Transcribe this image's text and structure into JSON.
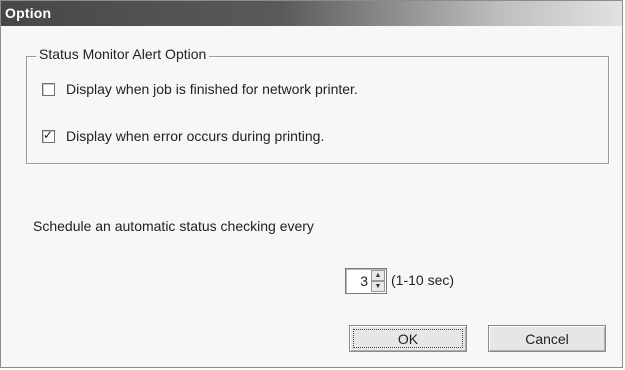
{
  "window": {
    "title": "Option"
  },
  "group": {
    "legend": "Status Monitor Alert Option",
    "options": [
      {
        "label": "Display when job is finished for network printer.",
        "checked": false
      },
      {
        "label": "Display when error occurs during printing.",
        "checked": true
      }
    ]
  },
  "schedule": {
    "label": "Schedule an automatic status checking every",
    "value": "3",
    "range_label": "(1-10 sec)"
  },
  "buttons": {
    "ok_label": "OK",
    "cancel_label": "Cancel"
  },
  "icons": {
    "check": "✓",
    "spin_up": "▲",
    "spin_down": "▼"
  }
}
